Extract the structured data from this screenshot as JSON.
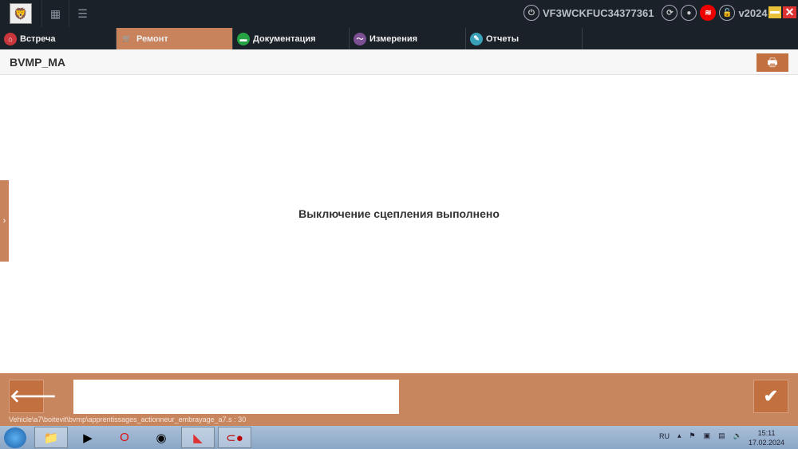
{
  "top": {
    "vin": "VF3WCKFUC34377361",
    "version": "v2024"
  },
  "tabs": [
    {
      "label": "Встреча",
      "color": "#c9363b"
    },
    {
      "label": "Ремонт",
      "color": "#c8835c"
    },
    {
      "label": "Документация",
      "color": "#25a244"
    },
    {
      "label": "Измерения",
      "color": "#7b4f92"
    },
    {
      "label": "Отчеты",
      "color": "#3aa0b8"
    }
  ],
  "header": {
    "title": "BVMP_MA"
  },
  "main": {
    "message": "Выключение сцепления выполнено"
  },
  "footer": {
    "input_value": "",
    "path": "Vehicle\\a7\\boitevit\\bvmp\\apprentissages_actionneur_embrayage_a7.s : 30"
  },
  "taskbar": {
    "lang": "RU",
    "time": "15:11",
    "date": "17.02.2024"
  }
}
